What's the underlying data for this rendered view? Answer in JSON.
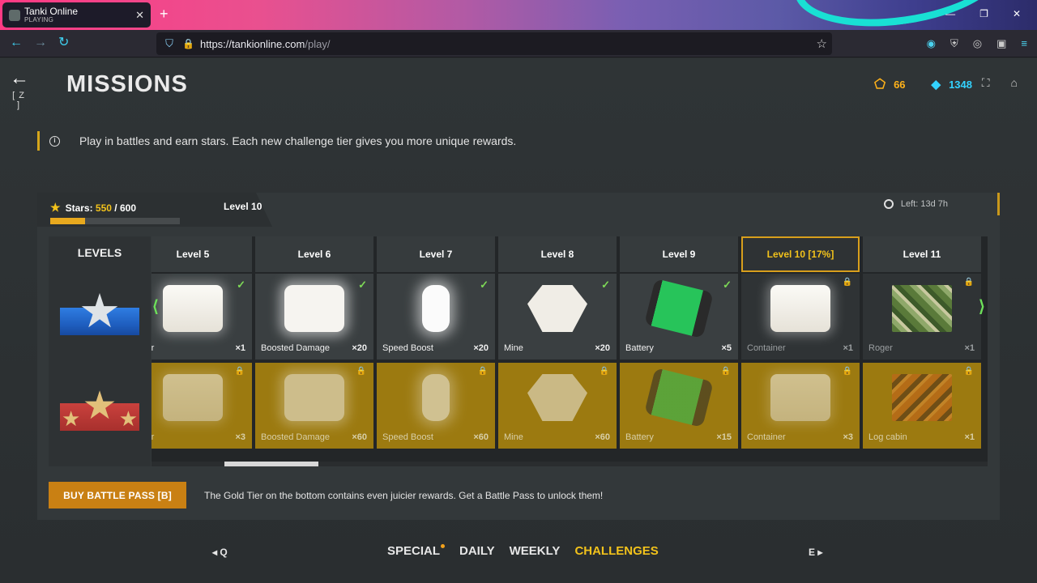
{
  "browser": {
    "tab_title": "Tanki Online",
    "tab_status": "PLAYING",
    "url_host": "https://tankionline.com",
    "url_path": "/play/"
  },
  "header": {
    "title": "MISSIONS",
    "back_key": "[ Z ]",
    "stars_count": "66",
    "crystals_count": "1348",
    "colors": {
      "stars": "#ffb21a",
      "crystals": "#33d2ff",
      "accent": "#f2c21b"
    }
  },
  "info": {
    "text": "Play in battles and earn stars. Each new challenge tier gives you more unique rewards."
  },
  "progress": {
    "stars_label": "Stars:",
    "stars_value": "550",
    "stars_total": "/ 600",
    "stars_fraction": 0.27,
    "current_level": "Level 10",
    "time_left": "Left: 13d 7h"
  },
  "levels_title": "LEVELS",
  "columns": [
    {
      "label": "Level 5",
      "active": false
    },
    {
      "label": "Level 6",
      "active": false
    },
    {
      "label": "Level 7",
      "active": false
    },
    {
      "label": "Level 8",
      "active": false
    },
    {
      "label": "Level 9",
      "active": false
    },
    {
      "label": "Level 10 [17%]",
      "active": true
    },
    {
      "label": "Level 11",
      "active": false
    }
  ],
  "free_row": [
    {
      "name": "iner",
      "qty": "×1",
      "icon": "crate",
      "state": "done"
    },
    {
      "name": "Boosted Damage",
      "qty": "×20",
      "icon": "boost",
      "state": "done"
    },
    {
      "name": "Speed Boost",
      "qty": "×20",
      "icon": "speed",
      "state": "done"
    },
    {
      "name": "Mine",
      "qty": "×20",
      "icon": "mine",
      "state": "done"
    },
    {
      "name": "Battery",
      "qty": "×5",
      "icon": "battery",
      "state": "done"
    },
    {
      "name": "Container",
      "qty": "×1",
      "icon": "crate",
      "state": "locked"
    },
    {
      "name": "Roger",
      "qty": "×1",
      "icon": "roger",
      "state": "locked"
    }
  ],
  "gold_row": [
    {
      "name": "iner",
      "qty": "×3",
      "icon": "crate"
    },
    {
      "name": "Boosted Damage",
      "qty": "×60",
      "icon": "boost"
    },
    {
      "name": "Speed Boost",
      "qty": "×60",
      "icon": "speed"
    },
    {
      "name": "Mine",
      "qty": "×60",
      "icon": "mine"
    },
    {
      "name": "Battery",
      "qty": "×15",
      "icon": "battery"
    },
    {
      "name": "Container",
      "qty": "×3",
      "icon": "crate"
    },
    {
      "name": "Log cabin",
      "qty": "×1",
      "icon": "logcabin"
    }
  ],
  "buy_button": "BUY BATTLE PASS [B]",
  "gold_note": "The Gold Tier on the bottom contains even juicier rewards. Get a Battle Pass to unlock them!",
  "bottom_nav": {
    "prev_key": "Q",
    "next_key": "E",
    "tabs": [
      {
        "label": "SPECIAL",
        "active": false,
        "dot": true
      },
      {
        "label": "DAILY",
        "active": false,
        "dot": false
      },
      {
        "label": "WEEKLY",
        "active": false,
        "dot": false
      },
      {
        "label": "CHALLENGES",
        "active": true,
        "dot": false
      }
    ]
  }
}
